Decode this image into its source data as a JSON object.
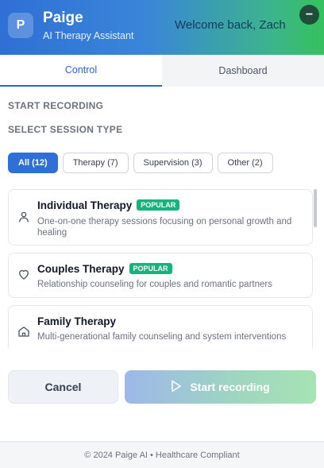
{
  "header": {
    "logo_letter": "P",
    "app_name": "Paige",
    "app_subtitle": "AI Therapy Assistant",
    "welcome": "Welcome back, Zach",
    "minimize_label": "−"
  },
  "tabs": [
    {
      "label": "Control",
      "active": true
    },
    {
      "label": "Dashboard",
      "active": false
    }
  ],
  "start_recording_heading": "START RECORDING",
  "session_type_heading": "SELECT SESSION TYPE",
  "filters": [
    {
      "label": "All (12)",
      "active": true
    },
    {
      "label": "Therapy (7)",
      "active": false
    },
    {
      "label": "Supervision (3)",
      "active": false
    },
    {
      "label": "Other (2)",
      "active": false
    }
  ],
  "sessions": [
    {
      "title": "Individual Therapy",
      "badge": "POPULAR",
      "description": "One-on-one therapy sessions focusing on personal growth and healing",
      "icon": "person-icon"
    },
    {
      "title": "Couples Therapy",
      "badge": "POPULAR",
      "description": "Relationship counseling for couples and romantic partners",
      "icon": "heart-icon"
    },
    {
      "title": "Family Therapy",
      "badge": "",
      "description": "Multi-generational family counseling and system interventions",
      "icon": "home-icon"
    }
  ],
  "actions": {
    "cancel": "Cancel",
    "start": "Start recording"
  },
  "footer": "© 2024 Paige AI • Healthcare Compliant",
  "colors": {
    "accent": "#2f6fd6",
    "badge": "#16b37a",
    "header_gradient_start": "#2f6fd6",
    "header_gradient_end": "#35c15c"
  }
}
